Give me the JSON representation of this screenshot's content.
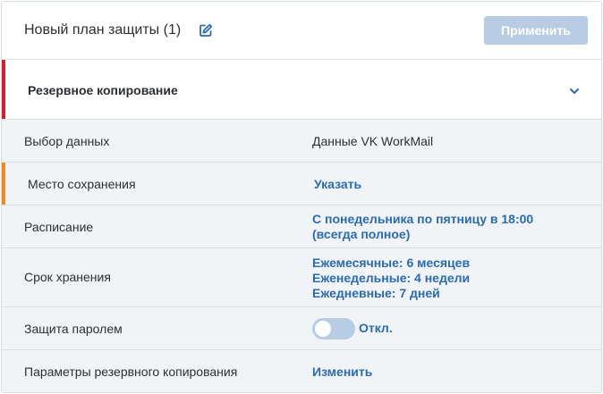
{
  "header": {
    "plan_title": "Новый план защиты (1)",
    "apply_label": "Применить"
  },
  "section": {
    "title": "Резервное копирование"
  },
  "rows": [
    {
      "label": "Выбор данных",
      "value": "Данные VK WorkMail"
    },
    {
      "label": "Место сохранения",
      "value": "Указать"
    },
    {
      "label": "Расписание",
      "value_lines": [
        "С понедельника по пятницу в 18:00",
        "(всегда полное)"
      ]
    },
    {
      "label": "Срок хранения",
      "value_lines": [
        "Ежемесячные: 6 месяцев",
        "Еженедельные: 4 недели",
        "Ежедневные: 7 дней"
      ]
    },
    {
      "label": "Защита паролем",
      "toggle_label": "Откл.",
      "toggle_on": false
    },
    {
      "label": "Параметры резервного копирования",
      "value": "Изменить"
    }
  ],
  "colors": {
    "accent_link": "#2a6bb3",
    "section_marker": "#d3202a",
    "attention_marker": "#f08a24",
    "disabled_button": "#b8cde3"
  },
  "icons": {
    "edit": "pencil-square-icon",
    "collapse": "chevron-down-icon"
  }
}
